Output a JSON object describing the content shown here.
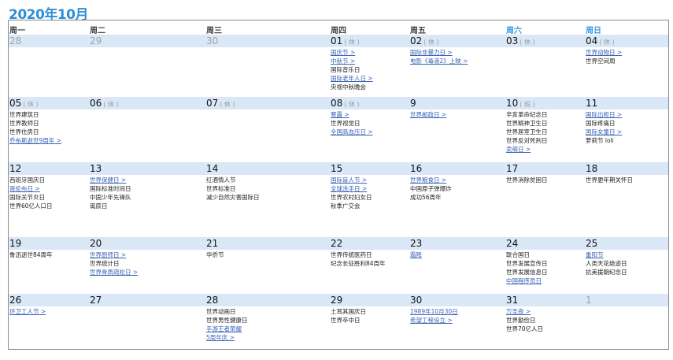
{
  "title": "2020年10月",
  "weekdays": [
    {
      "label": "周一",
      "weekend": false
    },
    {
      "label": "周二",
      "weekend": false
    },
    {
      "label": "周三",
      "weekend": false
    },
    {
      "label": "周四",
      "weekend": false
    },
    {
      "label": "周五",
      "weekend": false
    },
    {
      "label": "周六",
      "weekend": true
    },
    {
      "label": "周日",
      "weekend": true
    }
  ],
  "colors": {
    "title": "#2e8fd6",
    "weekend": "#3b9be0",
    "link": "#3a62b5",
    "date_bar": "#d9e7f6",
    "muted": "#a3a3a3"
  },
  "weeks": [
    {
      "days": [
        {
          "date": "28",
          "muted": true,
          "items": []
        },
        {
          "date": "29",
          "muted": true,
          "items": []
        },
        {
          "date": "30",
          "muted": true,
          "items": []
        },
        {
          "date": "01",
          "note": "( 休 )",
          "items": [
            {
              "text": "国庆节 >",
              "link": true
            },
            {
              "text": "中秋节 >",
              "link": true
            },
            {
              "text": "国际音乐日"
            },
            {
              "text": "国际老年人日 >",
              "link": true
            },
            {
              "text": "央视中秋晚会"
            }
          ]
        },
        {
          "date": "02",
          "note": "( 休 )",
          "items": [
            {
              "text": "国际非暴力日 >",
              "link": true
            },
            {
              "text": "电影《毒液2》上映 >",
              "link": true
            }
          ]
        },
        {
          "date": "03",
          "note": "( 休 )",
          "items": []
        },
        {
          "date": "04",
          "note": "( 休 )",
          "items": [
            {
              "text": "世界动物日 >",
              "link": true
            },
            {
              "text": "世界空间周"
            }
          ]
        }
      ]
    },
    {
      "days": [
        {
          "date": "05",
          "note": "( 休 )",
          "items": [
            {
              "text": "世界建筑日"
            },
            {
              "text": "世界教师日"
            },
            {
              "text": "世界住房日"
            },
            {
              "text": "乔布斯逝世9周年 >",
              "link": true
            }
          ]
        },
        {
          "date": "06",
          "note": "( 休 )",
          "items": []
        },
        {
          "date": "07",
          "note": "( 休 )",
          "items": []
        },
        {
          "date": "08",
          "note": "( 休 )",
          "items": [
            {
              "text": "寒露 >",
              "link": true
            },
            {
              "text": "世界视觉日"
            },
            {
              "text": "全国高血压日 >",
              "link": true
            }
          ]
        },
        {
          "date": "9",
          "items": [
            {
              "text": "世界邮政日 >",
              "link": true
            }
          ]
        },
        {
          "date": "10",
          "note": "( 班 )",
          "items": [
            {
              "text": "辛亥革命纪念日"
            },
            {
              "text": "世界精神卫生日"
            },
            {
              "text": "世界居室卫生日"
            },
            {
              "text": "世界反对死刑日"
            },
            {
              "text": "卖萌日 >",
              "link": true
            }
          ]
        },
        {
          "date": "11",
          "items": [
            {
              "text": "国际出柜日 >",
              "link": true
            },
            {
              "text": "国际疼痛日"
            },
            {
              "text": "国际女童日 >",
              "link": true
            },
            {
              "text": "萝莉节 loli"
            }
          ]
        }
      ]
    },
    {
      "days": [
        {
          "date": "12",
          "items": [
            {
              "text": "西班牙国庆日"
            },
            {
              "text": "哥伦布日 >",
              "link": true
            },
            {
              "text": "国际关节炎日"
            },
            {
              "text": "世界60亿人口日"
            }
          ]
        },
        {
          "date": "13",
          "items": [
            {
              "text": "世界保健日 >",
              "link": true
            },
            {
              "text": "国际标准时间日"
            },
            {
              "text": "中国少年先锋队"
            },
            {
              "text": "诞辰日"
            }
          ]
        },
        {
          "date": "14",
          "items": [
            {
              "text": "红酒情人节"
            },
            {
              "text": "世界标准日"
            },
            {
              "text": "减少自然灾害国际日"
            }
          ]
        },
        {
          "date": "15",
          "items": [
            {
              "text": "国际盲人节 >",
              "link": true
            },
            {
              "text": "全球洗手日 >",
              "link": true
            },
            {
              "text": "世界农村妇女日"
            },
            {
              "text": "秋季广交会"
            }
          ]
        },
        {
          "date": "16",
          "items": [
            {
              "text": "世界粮食日 >",
              "link": true
            },
            {
              "text": "中国原子弹爆炸"
            },
            {
              "text": "成功56周年"
            }
          ]
        },
        {
          "date": "17",
          "items": [
            {
              "text": "世界消除贫困日"
            }
          ]
        },
        {
          "date": "18",
          "items": [
            {
              "text": "世界更年期关怀日"
            }
          ]
        }
      ]
    },
    {
      "days": [
        {
          "date": "19",
          "items": [
            {
              "text": "鲁迅逝世84周年"
            }
          ]
        },
        {
          "date": "20",
          "items": [
            {
              "text": "世界厨师日 >",
              "link": true
            },
            {
              "text": "世界统计日"
            },
            {
              "text": "世界骨质疏松日 >",
              "link": true
            }
          ]
        },
        {
          "date": "21",
          "items": [
            {
              "text": "华侨节"
            }
          ]
        },
        {
          "date": "22",
          "items": [
            {
              "text": "世界传统医药日"
            },
            {
              "text": "纪念长征胜利84周年"
            }
          ]
        },
        {
          "date": "23",
          "items": [
            {
              "text": "霜降",
              "link": true
            }
          ]
        },
        {
          "date": "24",
          "items": [
            {
              "text": "联合国日"
            },
            {
              "text": "世界发展宣传日"
            },
            {
              "text": "世界发展信息日"
            },
            {
              "text": "中国程序员日",
              "link": true
            }
          ]
        },
        {
          "date": "25",
          "items": [
            {
              "text": "重阳节",
              "link": true
            },
            {
              "text": "人类天花绝迹日"
            },
            {
              "text": "抗美援朝纪念日"
            }
          ]
        }
      ]
    },
    {
      "days": [
        {
          "date": "26",
          "items": [
            {
              "text": "环卫工人节 >",
              "link": true
            }
          ]
        },
        {
          "date": "27",
          "items": []
        },
        {
          "date": "28",
          "items": [
            {
              "text": "世界动画日"
            },
            {
              "text": "世界男性健康日"
            },
            {
              "text": "手游王者荣耀",
              "link": true
            },
            {
              "text": "5周年庆 >",
              "link": true
            }
          ]
        },
        {
          "date": "29",
          "items": [
            {
              "text": "土耳其国庆日"
            },
            {
              "text": "世界卒中日"
            }
          ]
        },
        {
          "date": "30",
          "items": [
            {
              "text": "1989年10月30日",
              "link": true
            },
            {
              "text": "希望工程设立 >",
              "link": true
            }
          ]
        },
        {
          "date": "31",
          "items": [
            {
              "text": "万圣夜 >",
              "link": true
            },
            {
              "text": "世界勤俭日"
            },
            {
              "text": "世界70亿人日"
            }
          ]
        },
        {
          "date": "1",
          "muted": true,
          "items": []
        }
      ]
    }
  ]
}
